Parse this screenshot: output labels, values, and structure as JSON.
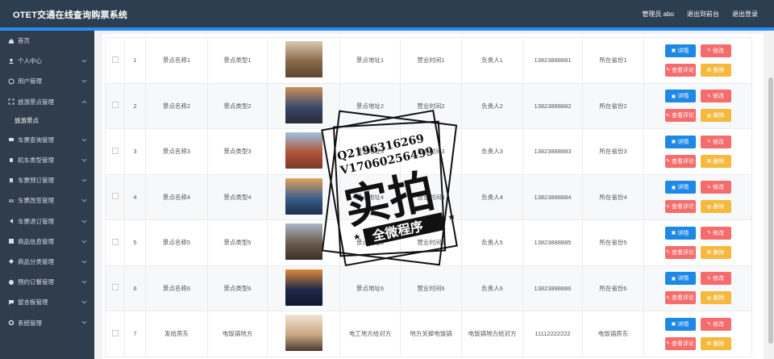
{
  "app": {
    "title": "OTET交通在线查询购票系统"
  },
  "header": {
    "admin": "管理员 abo",
    "back": "退出到前台",
    "logout": "退出登录"
  },
  "sidebar": {
    "items": [
      {
        "label": "首页",
        "icon": "home-icon"
      },
      {
        "label": "个人中心",
        "icon": "user-icon"
      },
      {
        "label": "用户管理",
        "icon": "users-icon"
      },
      {
        "label": "旅游景点管理",
        "icon": "scan-icon"
      },
      {
        "label": "车票查询管理",
        "icon": "ticket-icon"
      },
      {
        "label": "机车类型管理",
        "icon": "train-icon"
      },
      {
        "label": "车票预订管理",
        "icon": "bookmark-icon"
      },
      {
        "label": "车票改签管理",
        "icon": "swap-icon"
      },
      {
        "label": "车票退订管理",
        "icon": "return-icon"
      },
      {
        "label": "商品信息管理",
        "icon": "goods-icon"
      },
      {
        "label": "商品分类管理",
        "icon": "category-icon"
      },
      {
        "label": "预约订餐管理",
        "icon": "order-icon"
      },
      {
        "label": "留言板管理",
        "icon": "message-icon"
      },
      {
        "label": "系统管理",
        "icon": "settings-icon"
      }
    ],
    "sub_item": "旅游景点"
  },
  "buttons": {
    "detail": "详情",
    "edit": "修改",
    "comments": "查看评论",
    "delete": "删除"
  },
  "rows": [
    {
      "no": "1",
      "name": "景点名称1",
      "type": "景点类型1",
      "address": "景点地址1",
      "hours": "营业时间1",
      "manager": "负责人1",
      "phone": "13823888881",
      "province": "所在省份1",
      "photo": [
        "#8b6a4a",
        "#d8c9b0",
        "#5a4634"
      ]
    },
    {
      "no": "2",
      "name": "景点名称2",
      "type": "景点类型2",
      "address": "景点地址2",
      "hours": "营业时间2",
      "manager": "负责人2",
      "phone": "13823888882",
      "province": "所在省份2",
      "photo": [
        "#3a4a6b",
        "#c9925a",
        "#2a2a34"
      ]
    },
    {
      "no": "3",
      "name": "景点名称3",
      "type": "景点类型3",
      "address": "景点地址3",
      "hours": "营业时间3",
      "manager": "负责人3",
      "phone": "13823888883",
      "province": "所在省份3",
      "photo": [
        "#b0543a",
        "#9cc3e0",
        "#7a3a28"
      ]
    },
    {
      "no": "4",
      "name": "景点名称4",
      "type": "景点类型4",
      "address": "景点地址4",
      "hours": "营业时间4",
      "manager": "负责人4",
      "phone": "13823888884",
      "province": "所在省份4",
      "photo": [
        "#3b5e8a",
        "#e0a25a",
        "#1c2e48"
      ]
    },
    {
      "no": "5",
      "name": "景点名称5",
      "type": "景点类型5",
      "address": "景点地址5",
      "hours": "营业时间5",
      "manager": "负责人5",
      "phone": "13823888885",
      "province": "所在省份5",
      "photo": [
        "#6b5a4a",
        "#a8b8c8",
        "#3a3028"
      ]
    },
    {
      "no": "6",
      "name": "景点名称6",
      "type": "景点类型6",
      "address": "景点地址6",
      "hours": "营业时间6",
      "manager": "负责人6",
      "phone": "13823888886",
      "province": "所在省份6",
      "photo": [
        "#1e2a4a",
        "#e08a3a",
        "#10182e"
      ]
    },
    {
      "no": "7",
      "name": "发给房东",
      "type": "电饭锅地方",
      "address": "电工地方给对方",
      "hours": "地方关掉电饭锅",
      "manager": "电饭锅地方给对方",
      "phone": "11112222222",
      "province": "电饭锅房东",
      "photo": [
        "#c9a884",
        "#f0e4d4",
        "#4a3a30"
      ]
    }
  ],
  "watermark": {
    "line1": "Q2196316269",
    "line2": "V17060256499",
    "big": "实拍",
    "ribbon": "全微程序"
  },
  "colors": {
    "topbar": "#2c3e50",
    "accent": "#2a8cf0",
    "sidebar": "#2f3d4d",
    "blue_btn": "#1e88e5",
    "red_btn": "#f56c6c",
    "yellow_btn": "#f5b93d"
  }
}
